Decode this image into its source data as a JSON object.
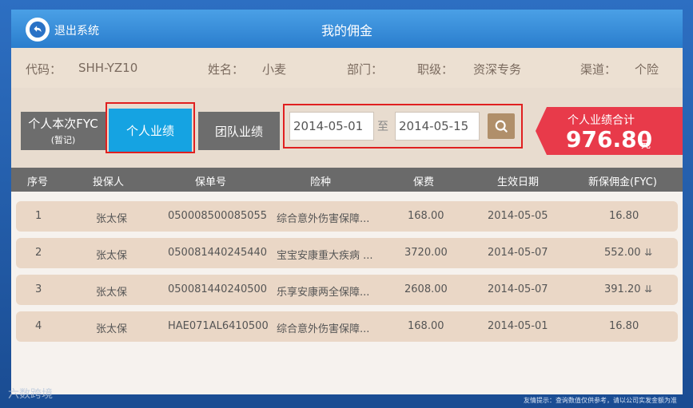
{
  "header": {
    "back_label": "退出系统",
    "title": "我的佣金"
  },
  "info": {
    "code_label": "代码：",
    "code_value": "SHH-YZ10",
    "name_label": "姓名：",
    "name_value": "小麦",
    "dept_label": "部门：",
    "rank_label": "职级：",
    "rank_value": "资深专务",
    "channel_label": "渠道：",
    "channel_value": "个险"
  },
  "tabs": {
    "fyc_line1": "个人本次FYC",
    "fyc_line2": "(暂记)",
    "personal": "个人业绩",
    "team": "团队业绩"
  },
  "date_filter": {
    "from": "2014-05-01",
    "separator": "至",
    "to": "2014-05-15"
  },
  "total": {
    "label": "个人业绩合计",
    "value": "976.80",
    "unit": "元"
  },
  "table": {
    "columns": [
      "序号",
      "投保人",
      "保单号",
      "险种",
      "保费",
      "生效日期",
      "新保佣金(FYC)"
    ],
    "rows": [
      {
        "no": "1",
        "holder": "张太保",
        "policy": "050008500085055",
        "product": "综合意外伤害保障...",
        "premium": "168.00",
        "date": "2014-05-05",
        "fyc": "16.80",
        "expand": false
      },
      {
        "no": "2",
        "holder": "张太保",
        "policy": "050081440245440",
        "product": "宝宝安康重大疾病 ...",
        "premium": "3720.00",
        "date": "2014-05-07",
        "fyc": "552.00",
        "expand": true
      },
      {
        "no": "3",
        "holder": "张太保",
        "policy": "050081440240500",
        "product": "乐享安康两全保障...",
        "premium": "2608.00",
        "date": "2014-05-07",
        "fyc": "391.20",
        "expand": true
      },
      {
        "no": "4",
        "holder": "张太保",
        "policy": "HAE071AL6410500",
        "product": "综合意外伤害保障...",
        "premium": "168.00",
        "date": "2014-05-01",
        "fyc": "16.80",
        "expand": false
      }
    ]
  },
  "footer": {
    "note": "友情提示：查询数值仅供参考，请以公司实发金额为准",
    "watermark": "六数跨境"
  },
  "colors": {
    "header_blue": "#2a7dcd",
    "active_tab": "#15a3e2",
    "total_red": "#e83a4a",
    "highlight_border": "#e02020"
  }
}
